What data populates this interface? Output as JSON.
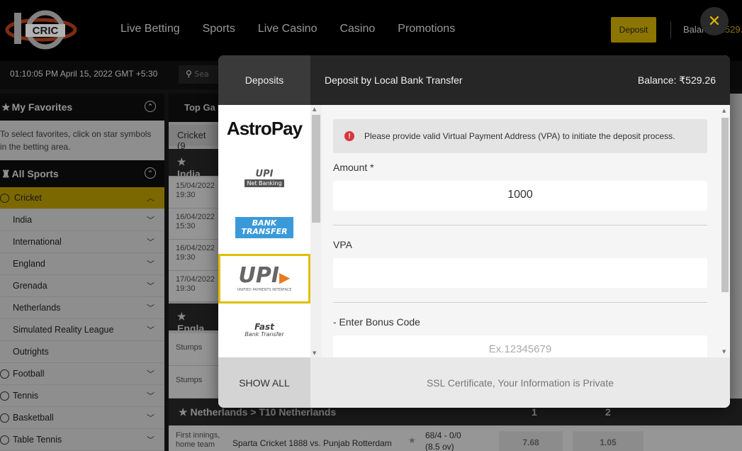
{
  "header": {
    "logo_text": "CRIC",
    "nav": [
      "Live Betting",
      "Sports",
      "Live Casino",
      "Casino",
      "Promotions"
    ],
    "deposit_label": "Deposit",
    "balance_label": "Balance",
    "balance_value": "₹529.",
    "close_glyph": "✕"
  },
  "subbar": {
    "datetime": "01:10:05 PM April 15, 2022 GMT +5:30",
    "search_placeholder": "Sea"
  },
  "sidebar": {
    "favorites_title": "My Favorites",
    "favorites_note": "To select favorites, click on star symbols in the betting area.",
    "all_sports_title": "All Sports",
    "items": [
      {
        "label": "Cricket",
        "type": "sport"
      },
      {
        "label": "India",
        "type": "sub"
      },
      {
        "label": "International",
        "type": "sub"
      },
      {
        "label": "England",
        "type": "sub"
      },
      {
        "label": "Grenada",
        "type": "sub"
      },
      {
        "label": "Netherlands",
        "type": "sub"
      },
      {
        "label": "Simulated Reality League",
        "type": "sub"
      },
      {
        "label": "Outrights",
        "type": "sub"
      },
      {
        "label": "Football",
        "type": "sport"
      },
      {
        "label": "Tennis",
        "type": "sport"
      },
      {
        "label": "Basketball",
        "type": "sport"
      },
      {
        "label": "Table Tennis",
        "type": "sport"
      }
    ]
  },
  "content": {
    "top_tab": "Top Ga",
    "cricket_row": "Cricket (9",
    "india_row": "India",
    "england_row": "Engla",
    "matches": [
      {
        "date": "15/04/2022",
        "time": "19:30"
      },
      {
        "date": "16/04/2022",
        "time": "15:30"
      },
      {
        "date": "16/04/2022",
        "time": "19:30"
      },
      {
        "date": "17/04/2022",
        "time": "19:30"
      }
    ],
    "stumps": [
      "Stumps",
      "Stumps"
    ],
    "netherlands_row": "Netherlands > T10 Netherlands",
    "col1": "1",
    "col2": "2",
    "last_match": {
      "innings": "First innings, home team",
      "teams": "Sparta Cricket 1888 vs. Punjab Rotterdam",
      "score": "68/4 - 0/0",
      "overs": "(8.5 ov)",
      "odd1": "7.68",
      "odd2": "1.05"
    }
  },
  "modal": {
    "tab": "Deposits",
    "title": "Deposit by Local Bank Transfer",
    "balance": "Balance: ₹529.26",
    "methods": [
      {
        "name": "AstroPay"
      },
      {
        "name": "UPI Net Banking",
        "line1": "UPI",
        "line2": "Net Banking"
      },
      {
        "name": "Bank Transfer",
        "line1": "BANK",
        "line2": "TRANSFER"
      },
      {
        "name": "UPI",
        "line1": "UPI",
        "line2": "UNIFIED PAYMENTS INTERFACE",
        "selected": true
      },
      {
        "name": "Fast Bank Transfer",
        "line1": "Fast",
        "line2": "Bank Transfer"
      }
    ],
    "alert": "Please provide valid Virtual Payment Address (VPA) to initiate the deposit process.",
    "amount_label": "Amount *",
    "amount_value": "1000",
    "vpa_label": "VPA",
    "vpa_value": "",
    "bonus_label": "- Enter Bonus Code",
    "bonus_placeholder": "Ex.12345679",
    "show_all": "SHOW ALL",
    "ssl_text": "SSL Certificate, Your Information is Private"
  },
  "colors": {
    "accent": "#c9a800",
    "header_bg": "#000000",
    "alert_icon": "#d9363e"
  }
}
